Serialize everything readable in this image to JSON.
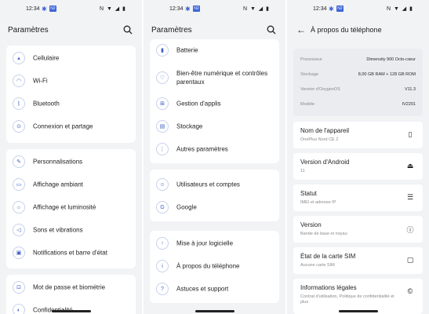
{
  "status": {
    "time": "12:34",
    "badge": "N2",
    "right_icons": "N ▼ ◢ ▮"
  },
  "panel1": {
    "title": "Paramètres",
    "group1": [
      "Cellulaire",
      "Wi-Fi",
      "Bluetooth",
      "Connexion et partage"
    ],
    "group2": [
      "Personnalisations",
      "Affichage ambiant",
      "Affichage et luminosité",
      "Sons et vibrations",
      "Notifications et barre d'état"
    ],
    "group3": [
      "Mot de passe et biométrie",
      "Confidentialité"
    ]
  },
  "panel2": {
    "title": "Paramètres",
    "group1": [
      "Batterie",
      "Bien-être numérique et contrôles parentaux",
      "Gestion d'applis",
      "Stockage",
      "Autres paramètres"
    ],
    "group2": [
      "Utilisateurs et comptes",
      "Google"
    ],
    "group3": [
      "Mise à jour logicielle",
      "À propos du téléphone",
      "Astuces et support"
    ]
  },
  "panel3": {
    "title": "À propos du téléphone",
    "info": [
      {
        "k": "Processeur",
        "v": "Dimensity 900 Octo-cœur"
      },
      {
        "k": "Stockage",
        "v": "8,00 GB RAM + 128 GB ROM"
      },
      {
        "k": "Version d'OxygenOS",
        "v": "V11.3"
      },
      {
        "k": "Modèle",
        "v": "IV2201"
      }
    ],
    "details": [
      {
        "t": "Nom de l'appareil",
        "s": "OnePlus Nord CE 2"
      },
      {
        "t": "Version d'Android",
        "s": "11"
      },
      {
        "t": "Statut",
        "s": "IMEI et adresse IP"
      },
      {
        "t": "Version",
        "s": "Bande de base et noyau"
      },
      {
        "t": "État de la carte SIM",
        "s": "Aucune carte SIM"
      },
      {
        "t": "Informations légales",
        "s": "Contrat d'utilisation, Politique de confidentialité et plus"
      }
    ]
  },
  "icons": {
    "p1g1": [
      "signal-icon",
      "wifi-icon",
      "bluetooth-icon",
      "share-icon"
    ],
    "p1g2": [
      "brush-icon",
      "ambient-icon",
      "brightness-icon",
      "sound-icon",
      "notification-icon"
    ],
    "p1g3": [
      "lock-icon",
      "privacy-icon"
    ],
    "p2g1": [
      "battery-icon",
      "wellbeing-icon",
      "apps-icon",
      "storage-icon",
      "more-icon"
    ],
    "p2g2": [
      "account-icon",
      "google-icon"
    ],
    "p2g3": [
      "update-icon",
      "info-icon",
      "help-icon"
    ]
  }
}
